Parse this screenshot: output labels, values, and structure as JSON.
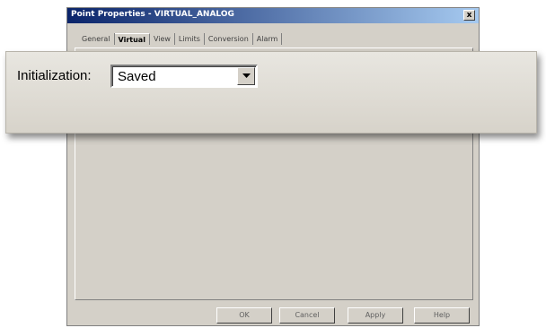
{
  "window": {
    "title": "Point Properties - VIRTUAL_ANALOG",
    "close_label": "x"
  },
  "tabs": [
    {
      "label": "General"
    },
    {
      "label": "Virtual"
    },
    {
      "label": "View"
    },
    {
      "label": "Limits"
    },
    {
      "label": "Conversion"
    },
    {
      "label": "Alarm"
    }
  ],
  "callout": {
    "field_label": "Initialization:",
    "field_value": "Saved"
  },
  "buttons": {
    "ok": "OK",
    "cancel": "Cancel",
    "apply": "Apply",
    "help": "Help"
  }
}
